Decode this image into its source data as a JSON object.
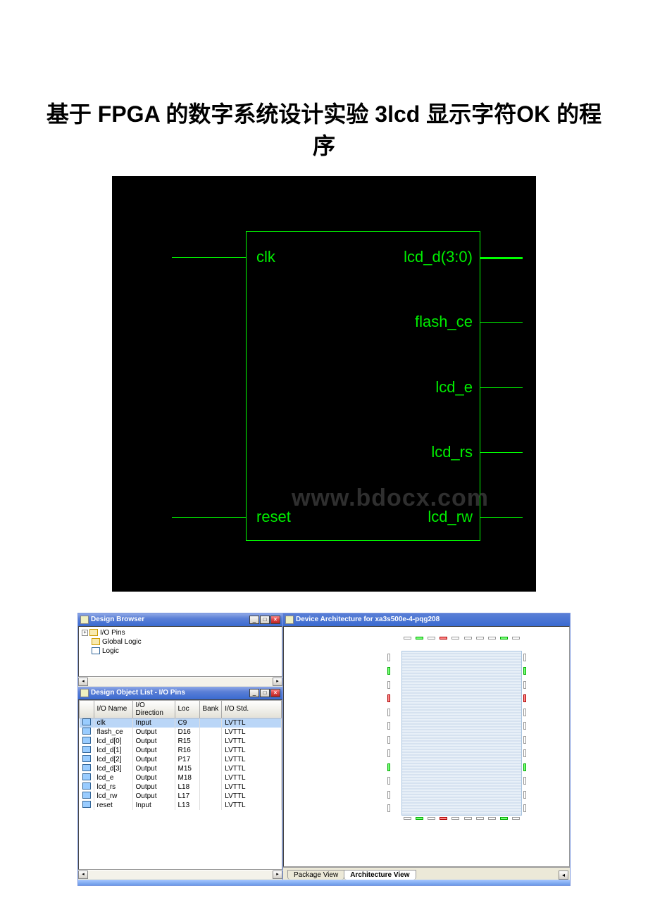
{
  "title": "基于 FPGA 的数字系统设计实验 3lcd 显示字符OK 的程序",
  "watermark": "www.bdocx.com",
  "schematic": {
    "ports_left": [
      {
        "label": "clk"
      },
      {
        "label": "reset"
      }
    ],
    "ports_right": [
      {
        "label": "lcd_d(3:0)"
      },
      {
        "label": "flash_ce"
      },
      {
        "label": "lcd_e"
      },
      {
        "label": "lcd_rs"
      },
      {
        "label": "lcd_rw"
      }
    ]
  },
  "browser": {
    "title": "Design Browser",
    "tree": [
      {
        "label": "I/O Pins",
        "expandable": true
      },
      {
        "label": "Global Logic"
      },
      {
        "label": "Logic"
      }
    ]
  },
  "objlist": {
    "title": "Design Object List - I/O Pins",
    "cols": [
      "",
      "I/O Name",
      "I/O Direction",
      "Loc",
      "Bank",
      "I/O Std."
    ],
    "rows": [
      {
        "name": "clk",
        "dir": "Input",
        "loc": "C9",
        "bank": "",
        "std": "LVTTL"
      },
      {
        "name": "flash_ce",
        "dir": "Output",
        "loc": "D16",
        "bank": "",
        "std": "LVTTL"
      },
      {
        "name": "lcd_d[0]",
        "dir": "Output",
        "loc": "R15",
        "bank": "",
        "std": "LVTTL"
      },
      {
        "name": "lcd_d[1]",
        "dir": "Output",
        "loc": "R16",
        "bank": "",
        "std": "LVTTL"
      },
      {
        "name": "lcd_d[2]",
        "dir": "Output",
        "loc": "P17",
        "bank": "",
        "std": "LVTTL"
      },
      {
        "name": "lcd_d[3]",
        "dir": "Output",
        "loc": "M15",
        "bank": "",
        "std": "LVTTL"
      },
      {
        "name": "lcd_e",
        "dir": "Output",
        "loc": "M18",
        "bank": "",
        "std": "LVTTL"
      },
      {
        "name": "lcd_rs",
        "dir": "Output",
        "loc": "L18",
        "bank": "",
        "std": "LVTTL"
      },
      {
        "name": "lcd_rw",
        "dir": "Output",
        "loc": "L17",
        "bank": "",
        "std": "LVTTL"
      },
      {
        "name": "reset",
        "dir": "Input",
        "loc": "L13",
        "bank": "",
        "std": "LVTTL"
      }
    ]
  },
  "device": {
    "title": "Device Architecture for xa3s500e-4-pqg208",
    "tabs": [
      {
        "label": "Package View"
      },
      {
        "label": "Architecture View"
      }
    ]
  }
}
